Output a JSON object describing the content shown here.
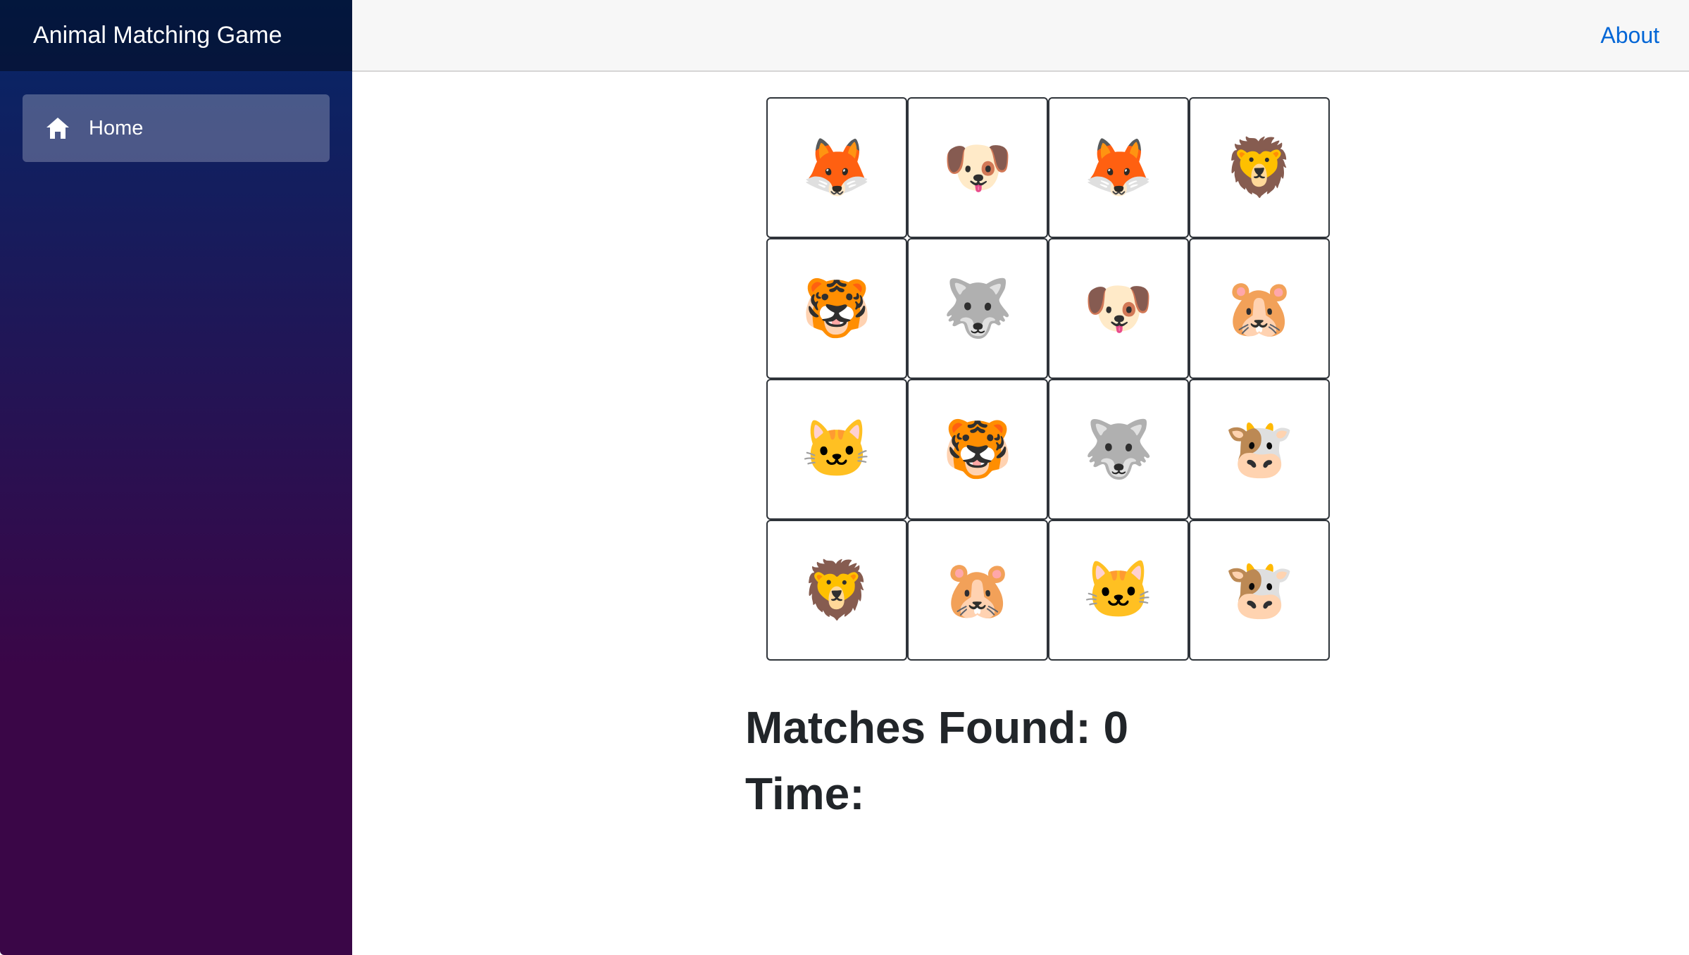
{
  "sidebar": {
    "brand": "Animal Matching Game",
    "nav_items": [
      {
        "label": "Home",
        "icon": "home-icon",
        "active": true
      }
    ]
  },
  "header": {
    "about_label": "About"
  },
  "game": {
    "tiles": [
      "🦊",
      "🐶",
      "🦊",
      "🦁",
      "🐯",
      "🐺",
      "🐶",
      "🐹",
      "🐱",
      "🐯",
      "🐺",
      "🐮",
      "🦁",
      "🐹",
      "🐱",
      "🐮"
    ],
    "matches_label": "Matches Found: 0",
    "time_label": "Time:"
  },
  "colors": {
    "sidebar_top": "#052767",
    "sidebar_bottom": "#3a0647",
    "link": "#0366d6",
    "text": "#212529"
  }
}
